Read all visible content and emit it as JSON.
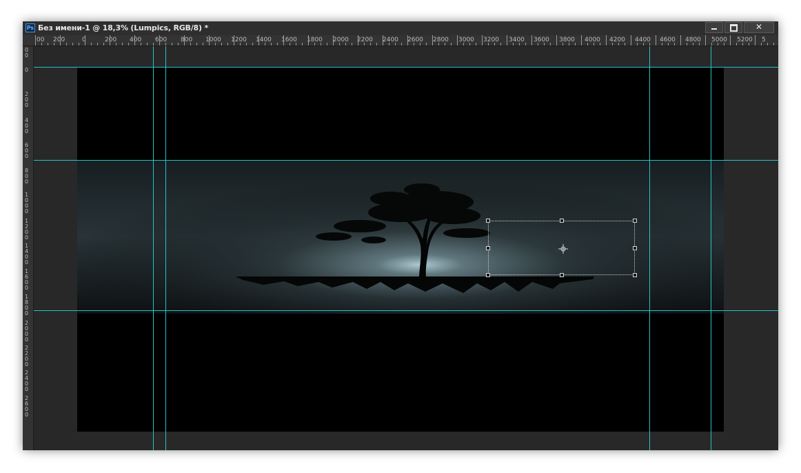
{
  "window": {
    "app_icon": "Ps",
    "title": "Без имени-1 @ 18,3% (Lumpics, RGB/8) *",
    "buttons": {
      "minimize": "minimize-icon",
      "maximize": "maximize-icon",
      "close": "✕"
    }
  },
  "ruler_top": {
    "labels": [
      "00",
      "200",
      "0",
      "200",
      "400",
      "600",
      "800",
      "1000",
      "1200",
      "1400",
      "1600",
      "1800",
      "2000",
      "2200",
      "2400",
      "2600",
      "2800",
      "3000",
      "3200",
      "3400",
      "3600",
      "3800",
      "4000",
      "4200",
      "4400",
      "4600",
      "4800",
      "5000",
      "5200",
      "5"
    ]
  },
  "ruler_left": {
    "labels": [
      "00",
      "0",
      "200",
      "400",
      "600",
      "800",
      "1000",
      "1200",
      "1400",
      "1600",
      "1800",
      "2000",
      "2200",
      "2400",
      "2600"
    ]
  },
  "canvas": {
    "layer_name": "Lumpics",
    "zoom": "18,3%",
    "color_mode": "RGB/8",
    "background_color": "#000000",
    "guide_color": "#26c4cc"
  },
  "selection": {
    "icon": "move-center-icon"
  }
}
